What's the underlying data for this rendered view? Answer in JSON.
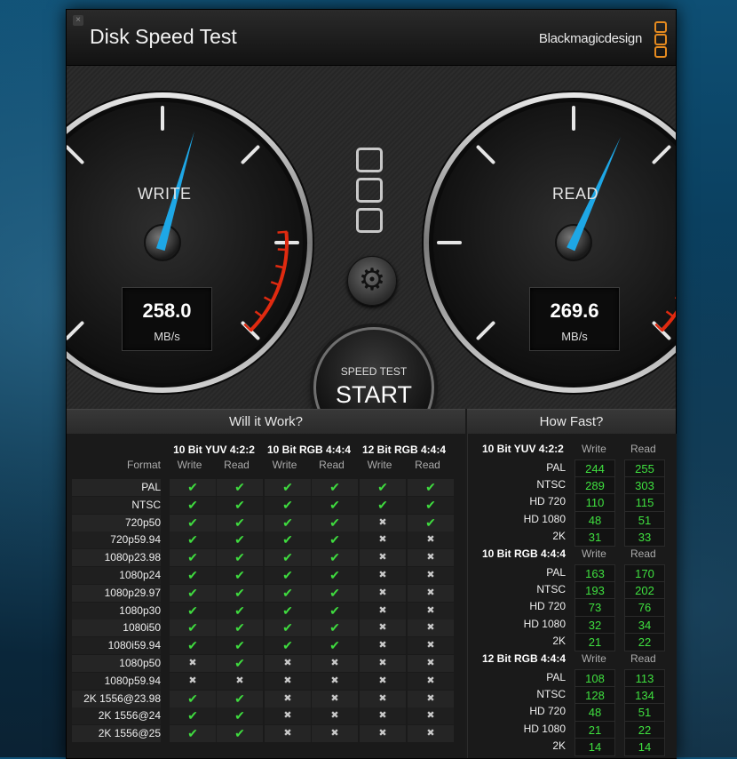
{
  "app": {
    "title": "Disk Speed Test",
    "brand": "Blackmagicdesign",
    "close_glyph": "×"
  },
  "colors": {
    "accent": "#e58a1f",
    "check": "#3fdc3f",
    "needle": "#1ea7e6",
    "redzone": "#e02a10"
  },
  "gauges": {
    "write": {
      "label": "WRITE",
      "value": "258.0",
      "unit": "MB/s"
    },
    "read": {
      "label": "READ",
      "value": "269.6",
      "unit": "MB/s"
    }
  },
  "start_button": {
    "small": "SPEED TEST",
    "big": "START"
  },
  "settings_icon": "gear-icon",
  "will_it_work": {
    "title": "Will it Work?",
    "format_header": "Format",
    "groups": [
      "10 Bit YUV 4:2:2",
      "10 Bit RGB 4:4:4",
      "12 Bit RGB 4:4:4"
    ],
    "sub_headers": [
      "Write",
      "Read"
    ],
    "rows": [
      {
        "format": "PAL",
        "cells": [
          1,
          1,
          1,
          1,
          1,
          1
        ]
      },
      {
        "format": "NTSC",
        "cells": [
          1,
          1,
          1,
          1,
          1,
          1
        ]
      },
      {
        "format": "720p50",
        "cells": [
          1,
          1,
          1,
          1,
          0,
          1
        ]
      },
      {
        "format": "720p59.94",
        "cells": [
          1,
          1,
          1,
          1,
          0,
          0
        ]
      },
      {
        "format": "1080p23.98",
        "cells": [
          1,
          1,
          1,
          1,
          0,
          0
        ]
      },
      {
        "format": "1080p24",
        "cells": [
          1,
          1,
          1,
          1,
          0,
          0
        ]
      },
      {
        "format": "1080p29.97",
        "cells": [
          1,
          1,
          1,
          1,
          0,
          0
        ]
      },
      {
        "format": "1080p30",
        "cells": [
          1,
          1,
          1,
          1,
          0,
          0
        ]
      },
      {
        "format": "1080i50",
        "cells": [
          1,
          1,
          1,
          1,
          0,
          0
        ]
      },
      {
        "format": "1080i59.94",
        "cells": [
          1,
          1,
          1,
          1,
          0,
          0
        ]
      },
      {
        "format": "1080p50",
        "cells": [
          0,
          1,
          0,
          0,
          0,
          0
        ]
      },
      {
        "format": "1080p59.94",
        "cells": [
          0,
          0,
          0,
          0,
          0,
          0
        ]
      },
      {
        "format": "2K 1556@23.98",
        "cells": [
          1,
          1,
          0,
          0,
          0,
          0
        ]
      },
      {
        "format": "2K 1556@24",
        "cells": [
          1,
          1,
          0,
          0,
          0,
          0
        ]
      },
      {
        "format": "2K 1556@25",
        "cells": [
          1,
          1,
          0,
          0,
          0,
          0
        ]
      }
    ],
    "check_glyph": "✔",
    "cross_glyph": "✖"
  },
  "how_fast": {
    "title": "How Fast?",
    "sub_headers": [
      "Write",
      "Read"
    ],
    "groups": [
      {
        "name": "10 Bit YUV 4:2:2",
        "rows": [
          {
            "format": "PAL",
            "write": "244",
            "read": "255"
          },
          {
            "format": "NTSC",
            "write": "289",
            "read": "303"
          },
          {
            "format": "HD 720",
            "write": "110",
            "read": "115"
          },
          {
            "format": "HD 1080",
            "write": "48",
            "read": "51"
          },
          {
            "format": "2K",
            "write": "31",
            "read": "33"
          }
        ]
      },
      {
        "name": "10 Bit RGB 4:4:4",
        "rows": [
          {
            "format": "PAL",
            "write": "163",
            "read": "170"
          },
          {
            "format": "NTSC",
            "write": "193",
            "read": "202"
          },
          {
            "format": "HD 720",
            "write": "73",
            "read": "76"
          },
          {
            "format": "HD 1080",
            "write": "32",
            "read": "34"
          },
          {
            "format": "2K",
            "write": "21",
            "read": "22"
          }
        ]
      },
      {
        "name": "12 Bit RGB 4:4:4",
        "rows": [
          {
            "format": "PAL",
            "write": "108",
            "read": "113"
          },
          {
            "format": "NTSC",
            "write": "128",
            "read": "134"
          },
          {
            "format": "HD 720",
            "write": "48",
            "read": "51"
          },
          {
            "format": "HD 1080",
            "write": "21",
            "read": "22"
          },
          {
            "format": "2K",
            "write": "14",
            "read": "14"
          }
        ]
      }
    ]
  }
}
